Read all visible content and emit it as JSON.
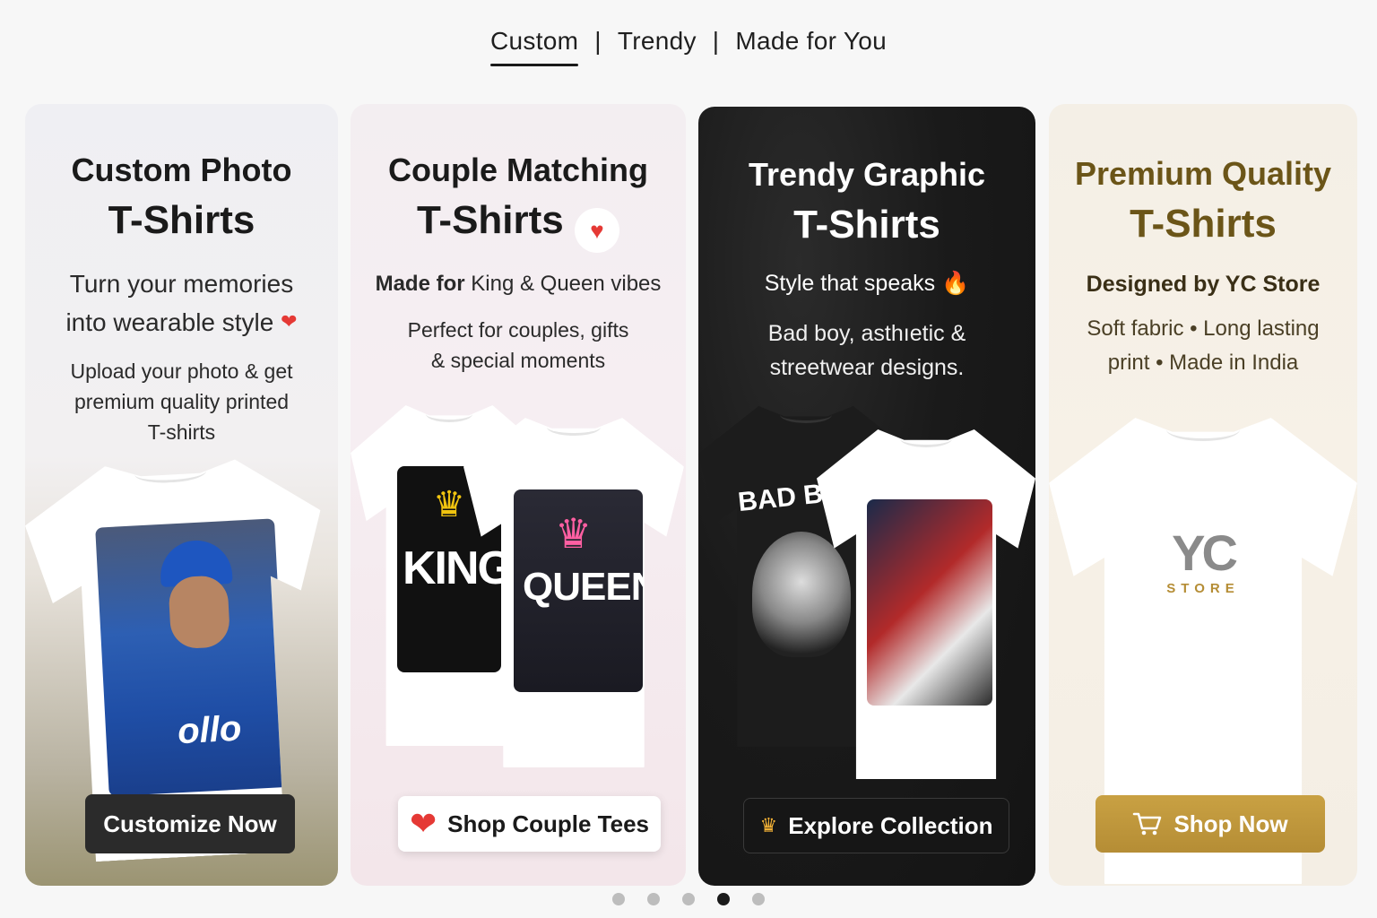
{
  "tabs": [
    {
      "label": "Custom",
      "active": true
    },
    {
      "label": "Trendy",
      "active": false
    },
    {
      "label": "Made for You",
      "active": false
    }
  ],
  "tab_separator": "|",
  "cards": [
    {
      "title_line1": "Custom Photo",
      "title_line2": "T-Shirts",
      "subtitle_line1": "Turn your memories",
      "subtitle_line2": "into wearable style",
      "description_line1": "Upload your photo & get",
      "description_line2": "premium quality printed",
      "description_line3": "T-shirts",
      "button_label": "Customize Now",
      "print_text": "ollo"
    },
    {
      "title_line1": "Couple Matching",
      "title_line2": "T-Shirts",
      "tagline_bold": "Made for",
      "tagline_rest": "King & Queen vibes",
      "description_line1": "Perfect for couples, gifts",
      "description_line2": "& special moments",
      "button_label": "Shop Couple Tees",
      "print_king": "KING",
      "print_queen": "QUEEN"
    },
    {
      "title_line1": "Trendy Graphic",
      "title_line2": "T-Shirts",
      "subtitle": "Style that speaks",
      "description_line1": "Bad boy, asthıetic &",
      "description_line2": "streetwear designs.",
      "button_label": "Explore Collection",
      "print_text": "BAD BOY"
    },
    {
      "title_line1": "Premium Quality",
      "title_line2": "T-Shirts",
      "subtitle": "Designed by YC Store",
      "description_line1": "Soft fabric • Long lasting",
      "description_line2": "print • Made in India",
      "button_label": "Shop Now",
      "logo_main": "YC",
      "logo_sub": "STORE"
    }
  ],
  "carousel": {
    "total": 5,
    "active_index": 3
  },
  "colors": {
    "gold": "#b58d35",
    "gold_title": "#6b5518",
    "dark_card": "#1a1a1a",
    "heart_red": "#e53935"
  }
}
